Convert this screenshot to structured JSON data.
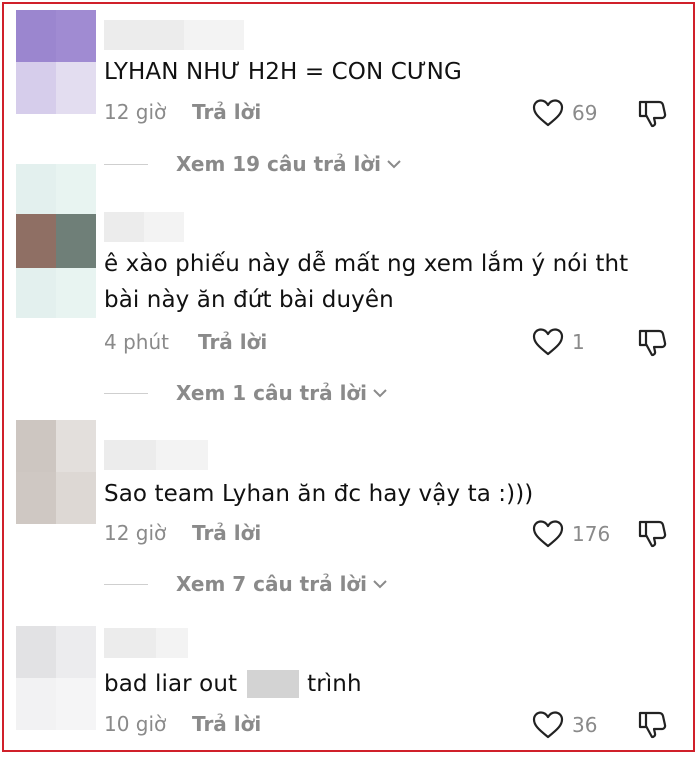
{
  "comments": [
    {
      "text": "LYHAN NHƯ H2H = CON CƯNG",
      "time": "12 giờ",
      "reply_label": "Trả lời",
      "likes": "69",
      "view_replies": "Xem 19 câu trả lời",
      "avatar_colors": [
        "#9b86cf",
        "#9b86cf",
        "#d6cdeb",
        "#e3ddf0"
      ]
    },
    {
      "text": "ê xào phiếu này dễ mất ng xem lắm ý nói tht\nbài này ăn đứt bài duyên",
      "time": "4 phút",
      "reply_label": "Trả lời",
      "likes": "1",
      "view_replies": "Xem 1 câu trả lời",
      "avatar_colors": [
        "#8f6f64",
        "#6f7f78",
        "#e3f0ee",
        "#e8f4f1"
      ]
    },
    {
      "text": "Sao team Lyhan ăn đc hay vậy ta :)))",
      "time": "12 giờ",
      "reply_label": "Trả lời",
      "likes": "176",
      "view_replies": "Xem 7 câu trả lời",
      "avatar_colors": [
        "#cdc6c1",
        "#e3dfdc",
        "#cfc8c3",
        "#ddd8d4"
      ]
    },
    {
      "text": "bad liar out",
      "text_suffix": "trình",
      "time": "10 giờ",
      "reply_label": "Trả lời",
      "likes": "36",
      "avatar_colors": [
        "#e2e2e4",
        "#ececee",
        "#f2f2f3",
        "#f5f5f6"
      ]
    }
  ],
  "colors": {
    "frame_border": "#d0202a",
    "text": "#111111",
    "muted": "#8a8a8a"
  },
  "icons": [
    "heart-icon",
    "dislike-icon",
    "chevron-down-icon"
  ]
}
